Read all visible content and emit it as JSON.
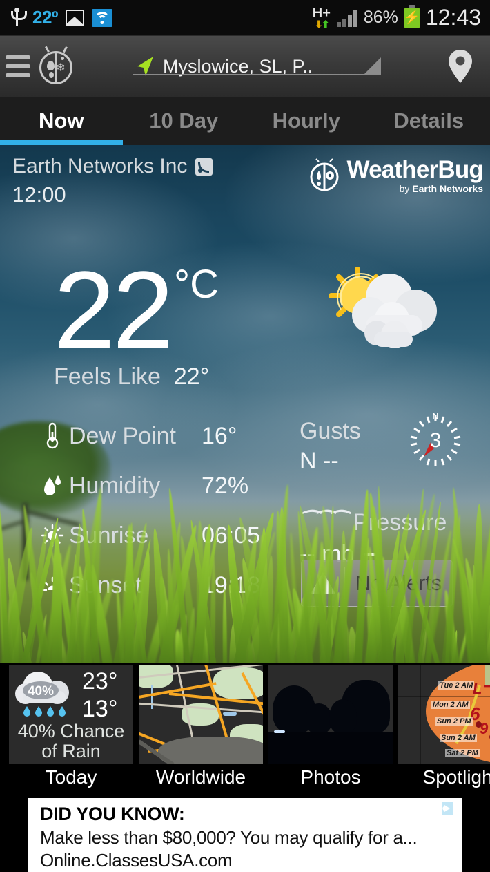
{
  "status_bar": {
    "usb_icon": "usb-icon",
    "temperature": "22º",
    "gallery_icon": "gallery-icon",
    "wifi_icon": "wifi-icon",
    "network_type": "H+",
    "network_arrows_icon": "data-transfer-icon",
    "signal_icon": "signal-bars-icon",
    "battery_percent": "86%",
    "battery_icon": "charging-battery-icon",
    "clock": "12:43"
  },
  "app_header": {
    "menu_icon": "hamburger-menu-icon",
    "app_logo_icon": "weatherbug-ladybug-icon",
    "gps_icon": "navigation-arrow-icon",
    "location": "Myslowice, SL, P..",
    "dropdown_icon": "dropdown-caret-icon",
    "pin_icon": "location-pin-icon"
  },
  "tabs": [
    {
      "label": "Now",
      "active": true
    },
    {
      "label": "10 Day",
      "active": false
    },
    {
      "label": "Hourly",
      "active": false
    },
    {
      "label": "Details",
      "active": false
    }
  ],
  "station": {
    "name": "Earth Networks Inc",
    "rss_icon": "rss-feed-icon",
    "observation_time": "12:00",
    "brand_name": "WeatherBug",
    "brand_tagline_prefix": "by ",
    "brand_tagline": "Earth Networks",
    "brand_tagline_tm": "℠",
    "brand_icon": "weatherbug-ladybug-icon"
  },
  "current": {
    "temperature": "22",
    "unit": "°C",
    "feels_like_label": "Feels Like",
    "feels_like_value": "22°",
    "condition_icon": "partly-cloudy-sun-icon"
  },
  "stats": [
    {
      "icon": "thermometer-icon",
      "label": "Dew Point",
      "value": "16°"
    },
    {
      "icon": "humidity-droplet-icon",
      "label": "Humidity",
      "value": "72%"
    },
    {
      "icon": "sunrise-icon",
      "label": "Sunrise",
      "value": "06:05"
    },
    {
      "icon": "sunset-icon",
      "label": "Sunset",
      "value": "19:18"
    }
  ],
  "wind": {
    "gusts_label": "Gusts",
    "gusts_value": "N --",
    "compass_north": "N",
    "compass_speed": "3",
    "compass_icon": "wind-compass-icon"
  },
  "pressure": {
    "icon": "pressure-icon",
    "label": "Pressure",
    "value": "-- mb",
    "trend_icon": "arrow-right-icon"
  },
  "alerts": {
    "icon": "warning-triangle-icon",
    "label": "No Alerts"
  },
  "cards": [
    {
      "caption": "Today",
      "kind": "forecast",
      "chance_badge": "40%",
      "high": "23°",
      "low": "13°",
      "summary": "40% Chance of Rain",
      "icon": "rain-cloud-icon"
    },
    {
      "caption": "Worldwide",
      "kind": "map",
      "icon": "road-map-thumbnail"
    },
    {
      "caption": "Photos",
      "kind": "photo",
      "icon": "photo-thumbnail"
    },
    {
      "caption": "Spotlight",
      "kind": "spotlight",
      "icon": "hurricane-track-map-thumbnail",
      "track_labels": [
        "Tue 2 AM",
        "Mon 2 AM",
        "Sun 2 PM",
        "Sun 2 AM",
        "Sat 2 PM"
      ]
    }
  ],
  "ad": {
    "headline": "DID YOU KNOW:",
    "body": "Make less than $80,000? You may qualify for a...",
    "url": "Online.ClassesUSA.com",
    "adchoices_icon": "adchoices-icon"
  },
  "colors": {
    "accent": "#32b0e8",
    "status_temp": "#32b0e8",
    "battery": "#7ec822",
    "sky_top": "#13384d",
    "grass": "#78913f"
  }
}
